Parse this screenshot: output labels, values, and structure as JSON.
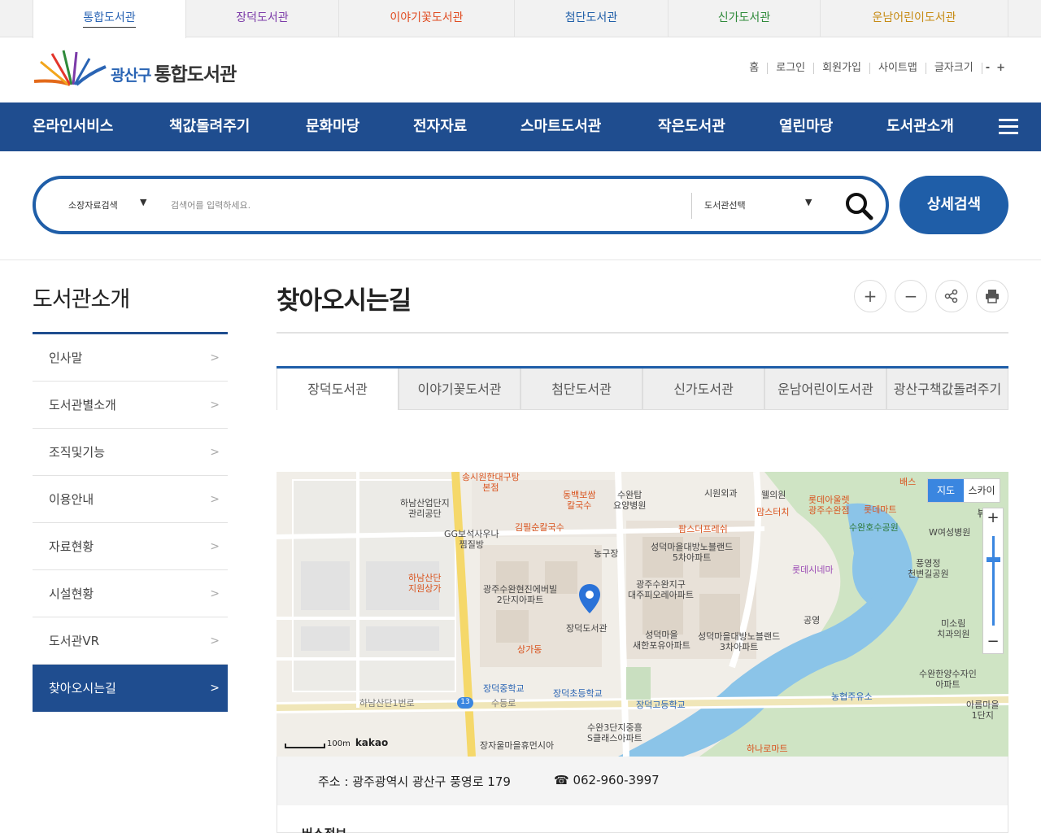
{
  "library_tabs": [
    "통합도서관",
    "장덕도서관",
    "이야기꽃도서관",
    "첨단도서관",
    "신가도서관",
    "운남어린이도서관"
  ],
  "header": {
    "logo_sub": "광산구",
    "logo_main": "통합도서관",
    "utils": [
      "홈",
      "로그인",
      "회원가입",
      "사이트맵",
      "글자크기"
    ],
    "font_minus": "-",
    "font_plus": "+"
  },
  "gnb": [
    "온라인서비스",
    "책값돌려주기",
    "문화마당",
    "전자자료",
    "스마트도서관",
    "작은도서관",
    "열린마당",
    "도서관소개"
  ],
  "search": {
    "type_label": "소장자료검색",
    "placeholder": "검색어를 입력하세요.",
    "library_label": "도서관선택",
    "advanced_label": "상세검색"
  },
  "side": {
    "title": "도서관소개",
    "items": [
      "인사말",
      "도서관별소개",
      "조직및기능",
      "이용안내",
      "자료현황",
      "시설현황",
      "도서관VR",
      "찾아오시는길"
    ]
  },
  "content": {
    "title": "찾아오시는길",
    "subtabs": [
      "장덕도서관",
      "이야기꽃도서관",
      "첨단도서관",
      "신가도서관",
      "운남어린이도서관",
      "광산구책값돌려주기"
    ]
  },
  "map": {
    "type_map": "지도",
    "type_sky": "스카이뷰",
    "scale": "100m",
    "brand": "kakao",
    "labels": {
      "l1": "송시원한대구탕\n본점",
      "l2": "동백보쌈\n칼국수",
      "l3": "수완탑\n요양병원",
      "l4": "시원외과",
      "l5": "웰의원",
      "l6": "롯데아울렛\n광주수완점",
      "l7": "롯데마트",
      "l8": "맘스터치",
      "l9": "하남산업단지\n관리공단",
      "l10": "GG보석사우나\n찜질방",
      "l11": "김필순칼국수",
      "l12": "팜스더프레쉬",
      "l13": "수완호수공원",
      "l14": "W여성병원",
      "l15": "성덕마을대방노블랜드\n5차아파트",
      "l16": "농구장",
      "l17": "하남산단\n지원상가",
      "l18": "광주수완현진에버빌\n2단지아파트",
      "l19": "광주수완지구\n대주피오레아파트",
      "l20": "롯데시네마",
      "l21": "풍영정\n천변길공원",
      "l22": "장덕도서관",
      "l23": "공영",
      "l24": "미소림\n치과의원",
      "l25": "성덕마을\n새한포유아파트",
      "l26": "성덕마을대방노블랜드\n3차아파트",
      "l27": "상가동",
      "l28": "장덕중학교",
      "l29": "장덕초등학교",
      "l30": "장덕고등학교",
      "l31": "농협주유소",
      "l32": "수완한양수자인\n아파트",
      "l33": "하남산단1번로",
      "l34": "수등로",
      "l35": "수완3단지중흥\nS클래스아파트",
      "l36": "장자울마을휴먼시아",
      "l37": "하나로마트",
      "l38": "아름마을\n1단지",
      "l39": "배스",
      "l40": "13"
    }
  },
  "address": {
    "addr": "주소 : 광주광역시 광산구 풍영로 179",
    "tel": "☎ 062-960-3997"
  },
  "info_heading": "버스정보"
}
